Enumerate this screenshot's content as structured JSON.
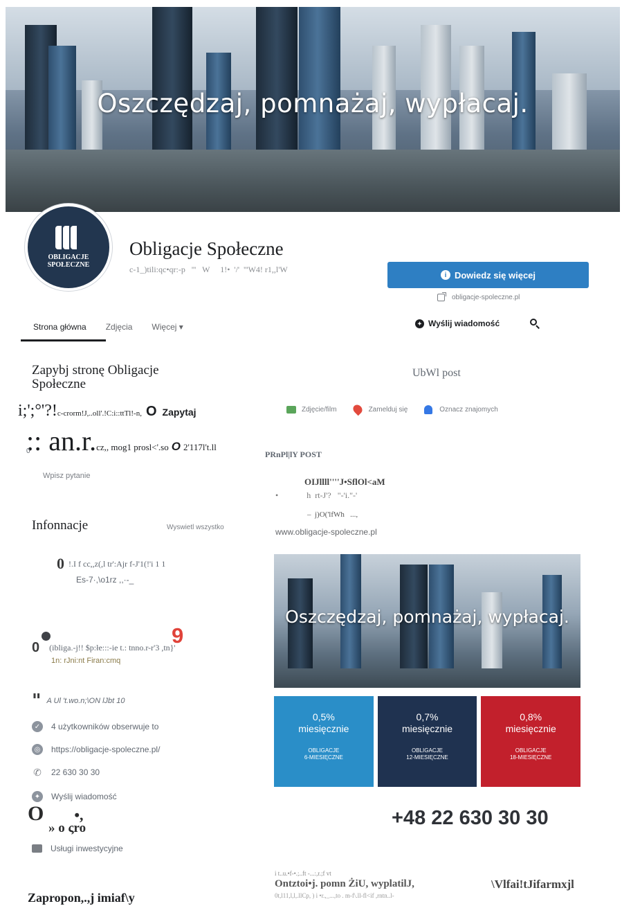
{
  "cover": {
    "headline": "Oszczędzaj, pomnażaj, wypłacaj."
  },
  "profile": {
    "logo_text": "OBLIGACJE\nSPOŁECZNE",
    "name": "Obligacje Społeczne",
    "subtitle": "c-1_)tili:qc•qr:-p   '''   W     1!•  '/'  '''W4! r1,,l'W"
  },
  "cta": {
    "label": "Dowiedz się więcej",
    "link": "obligacje-spoleczne.pl"
  },
  "tabs": [
    {
      "label": "Strona główna"
    },
    {
      "label": "Zdjęcia"
    },
    {
      "label": "Więcej ▾"
    }
  ],
  "actions": {
    "send_message": "Wyślij wiadomość"
  },
  "left": {
    "follow_title": "Zapybj stronę Obligacje Społeczne",
    "noise1": "i;';°'?!",
    "noise1_small": "c-crorm!J,..oll'.!C:i::ttTl!-n,",
    "noise1_o": "O",
    "noise1_ask": "Zapytaj",
    "noise2": ":: an.r.",
    "noise2_small": "cz,, mog1 prosl<'.so",
    "noise2_o": "O",
    "noise2_tail": "2'117l't.ll",
    "noise2_zero": "0",
    "ask_placeholder": "Wpisz pytanie",
    "info_title": "Infonnacje",
    "show_all": "Wyswietl wszystko",
    "about_o": "0",
    "about_text": "!.I f cc,,z(,l tr':Ajr  f-J'1(!'i 1 1",
    "about_text2": "Es-7·,\\o1rz ,,·-_",
    "nine": "9",
    "category_zero": "0",
    "category": "(ibliga.-j!! $p:łe:::-ie t.: tnno.r-r'3 ,tn}'",
    "category_sub": "1n:  rJni:nt  Firan:cmq",
    "quote_text": "A Ul  't.wo.n;\\ON lJbt 10",
    "followers": "4 użytkowników obserwuje to",
    "website": "https://obligacje-spoleczne.pl/",
    "phone": "22 630 30 30",
    "message": "Wyślij wiadomość",
    "big_zero": "O",
    "big_zero_tail": "•,",
    "big_zero_line2": "» o ςro",
    "services": "Usługi inwestycyjne",
    "bottom_title": "Zapropon,.,j imiaf\\y"
  },
  "right": {
    "create_post": "UbWl post",
    "post_actions": [
      {
        "label": "Zdjęcie/film"
      },
      {
        "label": "Zamelduj się"
      },
      {
        "label": "Oznacz znajomych"
      }
    ],
    "pinned_label": "PRnPl|lY POST",
    "post_author": "OIJllll''''J•SflOl<aM",
    "post_meta": "h  rt-J'?   \"-'i.\"-'",
    "post_meta_dot": "•",
    "post_meta2": "–  j)O('lfWh   ...,",
    "post_url": "www.obligacje-spoleczne.pl",
    "post_image_headline": "Oszczędzaj, pomnażaj, wypłacaj.",
    "bonds": [
      {
        "rate": "0,5%",
        "freq": "miesięcznie",
        "kind": "OBLIGACJE\n6-MIESIĘCZNE",
        "color": "#2a8ec8"
      },
      {
        "rate": "0,7%",
        "freq": "miesięcznie",
        "kind": "OBLIGACJE\n12-MIESIĘCZNE",
        "color": "#1f3250"
      },
      {
        "rate": "0,8%",
        "freq": "miesięcznie",
        "kind": "OBLIGACJE\n18-MIESIĘCZNE",
        "color": "#c2202c"
      }
    ],
    "phone_big": "+48 22 630 30 30",
    "tiny_noise": "i   t..u.•f-•.;..ft -...:,r.;f vt",
    "bottom_post": "Ontztoi•j. pomn  ŻiU, wyplatilJ,",
    "bottom_post2": "0t,l11,l,l,.llCp, ) i •r.,_...,to  . m-f\\.ll-fl<if ,rntn..l-",
    "bottom_right": "\\Vlfai!tJifarmxjl"
  },
  "colors": {
    "cta": "#2e7fc3",
    "accent_red": "#e0433a"
  }
}
